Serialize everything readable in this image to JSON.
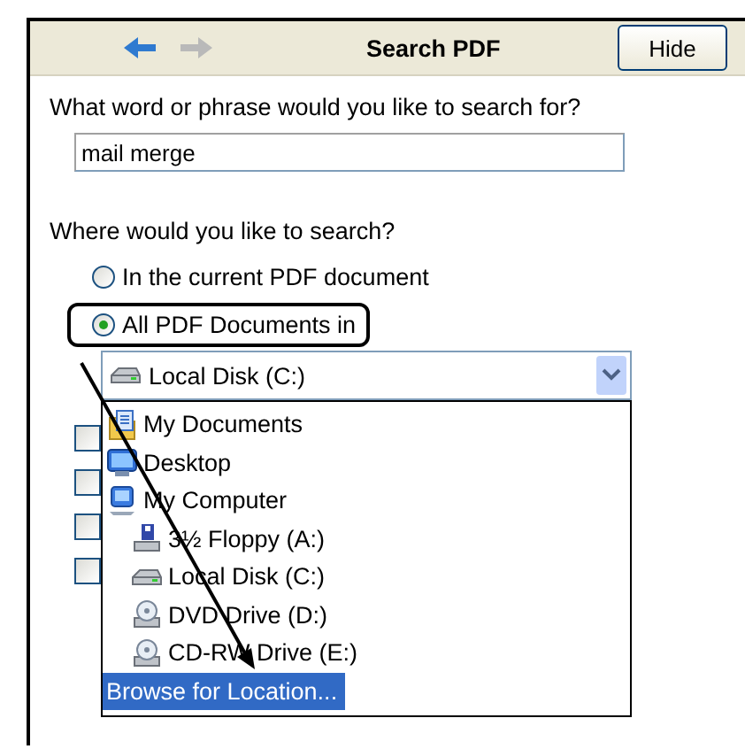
{
  "header": {
    "title": "Search PDF",
    "back": {
      "disabled": false
    },
    "forward": {
      "disabled": true
    },
    "button": "Hide"
  },
  "query": {
    "label": "What word or phrase would you like to search for?",
    "value": "mail merge"
  },
  "scope": {
    "label": "Where would you like to search?",
    "options": [
      {
        "label": "In the current PDF document",
        "selected": false,
        "highlighted": false
      },
      {
        "label": "All PDF Documents in",
        "selected": true,
        "highlighted": true
      }
    ]
  },
  "location": {
    "value": "Local Disk (C:)",
    "kind": "disk",
    "expanded": true,
    "items": [
      {
        "label": "My Documents",
        "kind": "documents",
        "selected": false
      },
      {
        "label": "Desktop",
        "kind": "desktop",
        "selected": false
      },
      {
        "label": "My Computer",
        "kind": "computer",
        "selected": false,
        "children": [
          {
            "label": "3½ Floppy (A:)",
            "kind": "floppy",
            "selected": false
          },
          {
            "label": "Local Disk (C:)",
            "kind": "disk",
            "selected": false
          },
          {
            "label": "DVD Drive (D:)",
            "kind": "cd",
            "selected": false
          },
          {
            "label": "CD-RW Drive (E:)",
            "kind": "cd",
            "selected": false
          }
        ]
      },
      {
        "label": "Browse for Location...",
        "kind": "browse",
        "selected": true
      }
    ]
  },
  "checkboxes": [
    {
      "checked": false
    },
    {
      "checked": false
    },
    {
      "checked": false
    },
    {
      "checked": false
    }
  ]
}
